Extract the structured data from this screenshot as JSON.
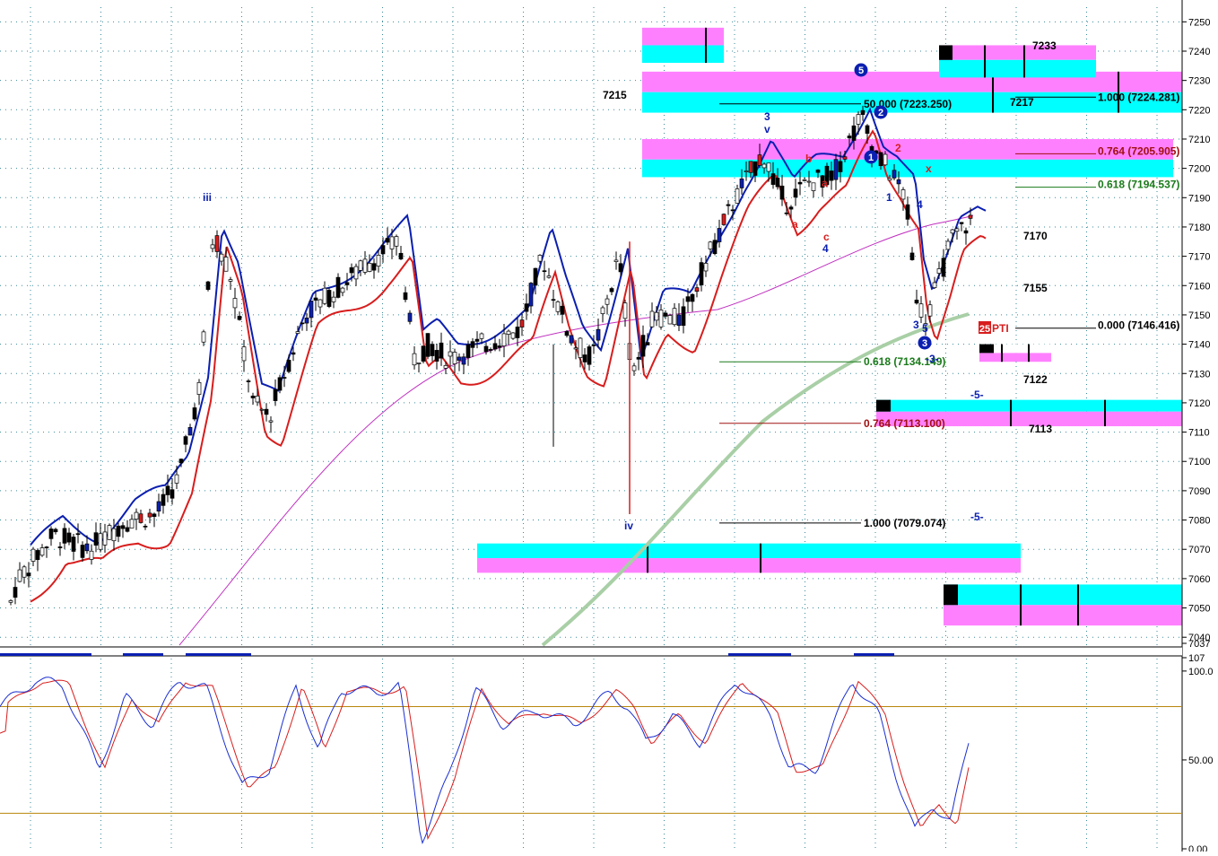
{
  "chart_data": {
    "type": "candlestick",
    "price_panel": {
      "ylim": [
        7037,
        7255
      ],
      "y_ticks": [
        "7250",
        "7240",
        "7230",
        "7220",
        "7210",
        "7200",
        "7190",
        "7180",
        "7170",
        "7160",
        "7150",
        "7140",
        "7130",
        "7120",
        "7110",
        "7100",
        "7090",
        "7080",
        "7070",
        "7060",
        "7050",
        "7040",
        "7037"
      ],
      "grid": true,
      "series_colors": {
        "fast_band_blue": "#0b1fb0",
        "fast_band_red": "#d81d1d",
        "ma_magenta": "#c030c0",
        "ma_long_green": "#a9cfa6"
      },
      "zone_colors": {
        "cyan": "#00ffff",
        "magenta": "#ff80ff"
      },
      "price_levels": [
        {
          "label": "7215",
          "price": 7215
        },
        {
          "label": "7217",
          "price": 7217
        },
        {
          "label": "7233",
          "price": 7233
        },
        {
          "label": "7170",
          "price": 7170
        },
        {
          "label": "7155",
          "price": 7155
        },
        {
          "label": "7122",
          "price": 7122
        },
        {
          "label": "7113",
          "price": 7113
        }
      ],
      "fib_left": [
        {
          "label": "50.000 (7223.250)",
          "ratio": 0.5,
          "price": 7223.25,
          "color": "#000000"
        },
        {
          "label": "0.618 (7134.149)",
          "ratio": 0.618,
          "price": 7134.149,
          "color": "#1a7a1a"
        },
        {
          "label": "0.764 (7113.100)",
          "ratio": 0.764,
          "price": 7113.1,
          "color": "#a01010"
        },
        {
          "label": "1.000 (7079.074)",
          "ratio": 1.0,
          "price": 7079.074,
          "color": "#000000"
        }
      ],
      "fib_right": [
        {
          "label": "1.000 (7224.281)",
          "ratio": 1.0,
          "price": 7224.281,
          "color": "#000000"
        },
        {
          "label": "0.764 (7205.905)",
          "ratio": 0.764,
          "price": 7205.905,
          "color": "#a01010"
        },
        {
          "label": "0.618 (7194.537)",
          "ratio": 0.618,
          "price": 7194.537,
          "color": "#1a7a1a"
        },
        {
          "label": "0.000 (7146.416)",
          "ratio": 0.0,
          "price": 7146.416,
          "color": "#000000"
        }
      ],
      "wave_labels": [
        {
          "text": "iii",
          "color": "#0b1fb0"
        },
        {
          "text": "iv",
          "color": "#0b1fb0"
        },
        {
          "text": "3",
          "color": "#0b1fb0"
        },
        {
          "text": "v",
          "color": "#0b1fb0"
        },
        {
          "text": "a",
          "color": "#d81d1d"
        },
        {
          "text": "b",
          "color": "#d81d1d"
        },
        {
          "text": "a",
          "color": "#d81d1d"
        },
        {
          "text": "c",
          "color": "#d81d1d"
        },
        {
          "text": "4",
          "color": "#0b1fb0"
        },
        {
          "text": "1",
          "color": "#0b1fb0"
        },
        {
          "text": "2",
          "color": "#d81d1d"
        },
        {
          "text": "4",
          "color": "#0b1fb0"
        },
        {
          "text": "3",
          "color": "#0b1fb0"
        },
        {
          "text": "5",
          "color": "#0b1fb0"
        },
        {
          "text": "x",
          "color": "#d81d1d"
        },
        {
          "text": "-3-",
          "color": "#0b1fb0"
        },
        {
          "text": "-5-",
          "color": "#0b1fb0"
        },
        {
          "text": "-5-",
          "color": "#0b1fb0"
        }
      ],
      "circled_labels": [
        "5",
        "2",
        "1",
        "3"
      ],
      "pti_badge": {
        "number": "25",
        "text": "PTI"
      }
    },
    "oscillator_panel": {
      "ylim": [
        0,
        107
      ],
      "y_ticks": [
        "107",
        "100.0",
        "50.00",
        "0.00"
      ],
      "levels": [
        80,
        20
      ],
      "series_colors": {
        "k": "#1a2fd0",
        "d": "#d81d1d",
        "levels": "#b8860b"
      }
    }
  }
}
